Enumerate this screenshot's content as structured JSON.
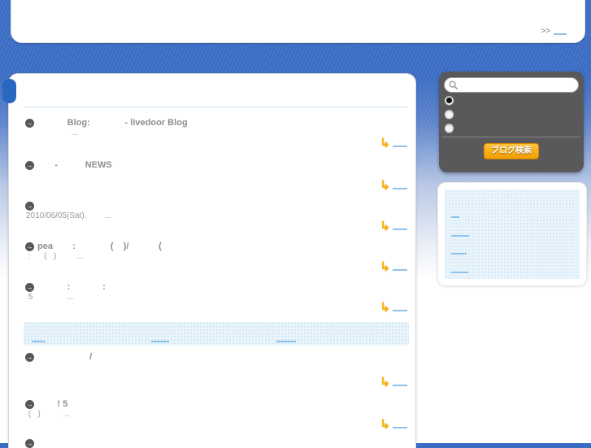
{
  "colors": {
    "accent_blue": "#3b6cc4",
    "tab_blue": "#2a67c0",
    "link_underline": "#8cc3ea",
    "button_gold": "#f29d00",
    "panel_gray": "#59595b"
  },
  "header": {
    "more_prefix": ">>",
    "more_link_label": ""
  },
  "main": {
    "items": [
      {
        "title": "            Blog:              - livedoor Blog",
        "snippet": "                    ...",
        "more_label": ""
      },
      {
        "title": "       -           NEWS",
        "snippet": "",
        "more_label": ""
      },
      {
        "title": "",
        "snippet": "2010/06/05(Sat).        ...",
        "more_label": ""
      },
      {
        "title": "pea        :              (    )/            (",
        "snippet": " :      (   )         ...",
        "more_label": ""
      },
      {
        "title": "            :             :",
        "snippet": " 5               ...",
        "more_label": ""
      },
      {
        "title": "                     /",
        "snippet": "",
        "more_label": ""
      },
      {
        "title": "        ! 5",
        "snippet": " (   )          ...",
        "more_label": ""
      },
      {
        "title": "",
        "snippet": "",
        "more_label": ""
      }
    ],
    "banner_links": [
      "",
      "",
      ""
    ]
  },
  "sidebar": {
    "search": {
      "input_value": "",
      "button_label": "ブログ検索",
      "radios": [
        {
          "label": "",
          "selected": true
        },
        {
          "label": "",
          "selected": false
        },
        {
          "label": "",
          "selected": false
        }
      ]
    },
    "links": [
      "",
      "",
      "",
      ""
    ]
  }
}
